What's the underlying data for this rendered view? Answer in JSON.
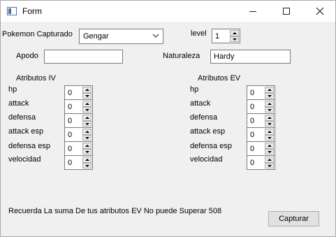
{
  "window": {
    "title": "Form"
  },
  "pokemon": {
    "label": "Pokemon Capturado",
    "selected": "Gengar"
  },
  "level": {
    "label": "level",
    "value": "1"
  },
  "apodo": {
    "label": "Apodo",
    "value": ""
  },
  "naturaleza": {
    "label": "Naturaleza",
    "value": "Hardy"
  },
  "iv": {
    "title": "Atributos IV",
    "stats": [
      {
        "label": "hp",
        "value": "0"
      },
      {
        "label": "attack",
        "value": "0"
      },
      {
        "label": "defensa",
        "value": "0"
      },
      {
        "label": "attack esp",
        "value": "0"
      },
      {
        "label": "defensa esp",
        "value": "0"
      },
      {
        "label": "velocidad",
        "value": "0"
      }
    ]
  },
  "ev": {
    "title": "Atributos EV",
    "stats": [
      {
        "label": "hp",
        "value": "0"
      },
      {
        "label": "attack",
        "value": "0"
      },
      {
        "label": "defensa",
        "value": "0"
      },
      {
        "label": "attack esp",
        "value": "0"
      },
      {
        "label": "defensa esp",
        "value": "0"
      },
      {
        "label": "velocidad",
        "value": "0"
      }
    ]
  },
  "footer": {
    "note": "Recuerda La suma De tus atributos EV No puede Superar 508",
    "capture_label": "Capturar"
  },
  "colors": {
    "window_bg": "#f0f0f0",
    "titlebar_bg": "#ffffff",
    "field_border": "#7a7a7a",
    "button_bg": "#e1e1e1"
  }
}
